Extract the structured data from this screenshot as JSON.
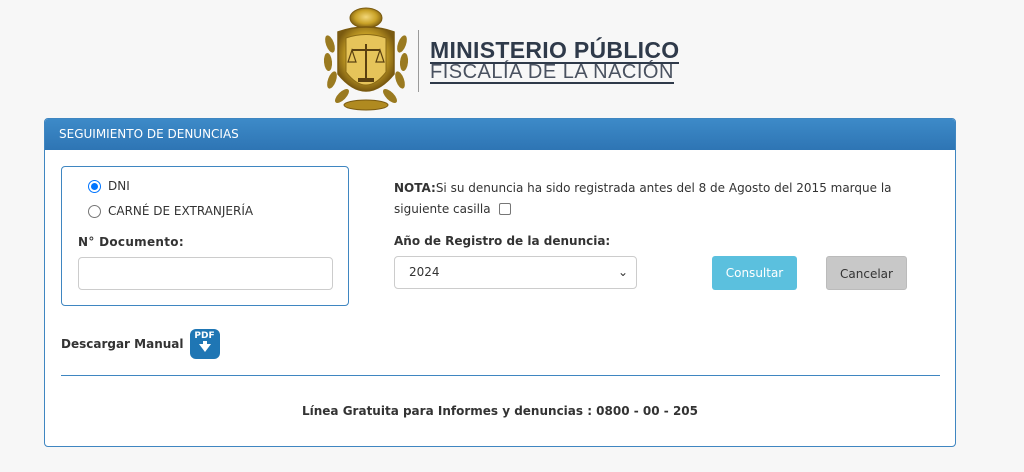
{
  "brand": {
    "line1": "MINISTERIO PÚBLICO",
    "line2": "FISCALÍA DE LA NACIÓN"
  },
  "panel": {
    "title": "SEGUIMIENTO DE DENUNCIAS"
  },
  "document": {
    "options": [
      {
        "label": "DNI",
        "checked": true
      },
      {
        "label": "CARNÉ DE EXTRANJERÍA",
        "checked": false
      }
    ],
    "number_label": "N° Documento:",
    "number_value": ""
  },
  "nota": {
    "prefix": "NOTA:",
    "text": "Si su denuncia ha sido registrada antes del 8 de Agosto del 2015 marque la siguiente casilla"
  },
  "year": {
    "label": "Año de Registro de la denuncia:",
    "selected": "2024"
  },
  "buttons": {
    "consultar": "Consultar",
    "cancelar": "Cancelar"
  },
  "manual": {
    "label": "Descargar Manual",
    "icon_text": "PDF"
  },
  "footer": {
    "text": "Línea Gratuita para Informes y denuncias : 0800 - 00 - 205"
  },
  "colors": {
    "primary": "#2e75b4",
    "consultar": "#5bc0de",
    "cancelar": "#c8c8c8",
    "seal_gold": "#c9a227"
  }
}
